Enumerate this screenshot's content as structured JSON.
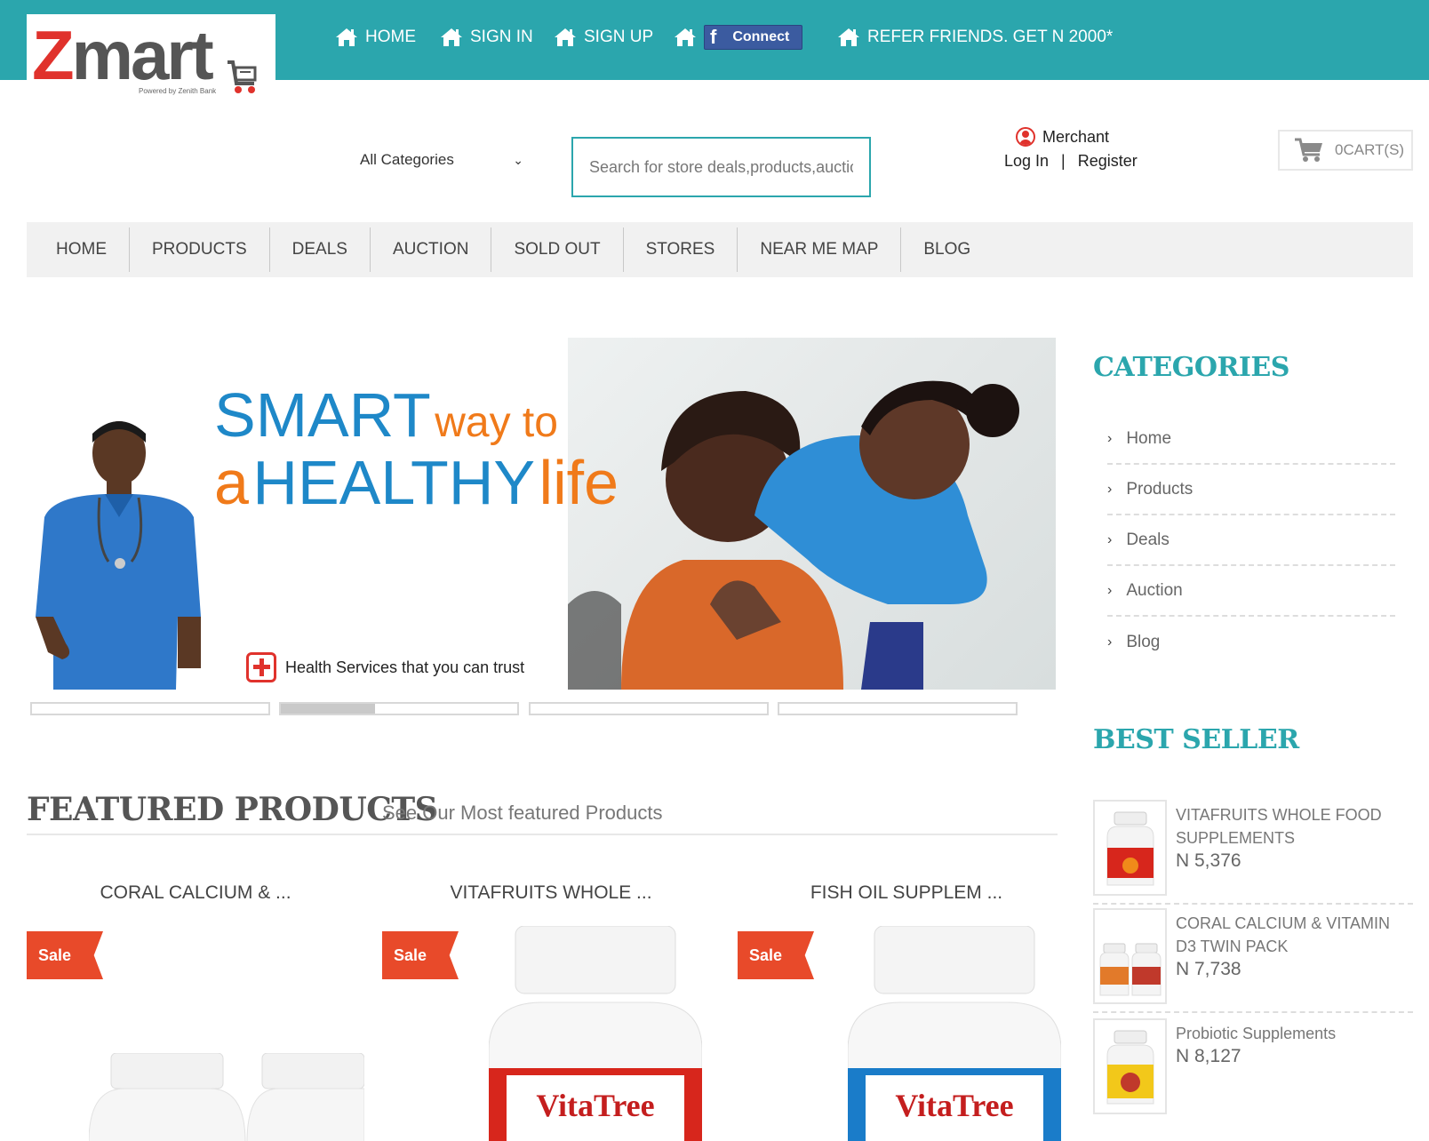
{
  "header": {
    "logo_text_z": "Z",
    "logo_text_rest": "mart",
    "logo_sub": "Powered by Zenith Bank",
    "top_nav": [
      {
        "label": "HOME"
      },
      {
        "label": "SIGN IN"
      },
      {
        "label": "SIGN UP"
      },
      {
        "label": ""
      },
      {
        "label": "REFER FRIENDS. GET N 2000*"
      }
    ],
    "facebook_connect_label": "Connect",
    "category_select": "All Categories",
    "search_placeholder": "Search for store deals,products,auctions",
    "merchant_label": "Merchant",
    "login_label": "Log In",
    "separator": "|",
    "register_label": "Register",
    "cart_label": "0CART(S)"
  },
  "main_nav": [
    "HOME",
    "PRODUCTS",
    "DEALS",
    "AUCTION",
    "SOLD OUT",
    "STORES",
    "NEAR ME MAP",
    "BLOG"
  ],
  "banner": {
    "line1_a": "SMART",
    "line1_b": "way to",
    "line2_a": "a",
    "line2_b": "HEALTHY",
    "line2_c": "life",
    "trust_text": "Health Services that you can trust",
    "slides": [
      {
        "progress": 0
      },
      {
        "progress": 0.4
      },
      {
        "progress": 0
      },
      {
        "progress": 0
      }
    ]
  },
  "featured": {
    "title": "FEATURED PRODUCTS",
    "subtitle": "See Our Most featured Products",
    "products": [
      {
        "name": "CORAL CALCIUM & ...",
        "badge": "Sale"
      },
      {
        "name": "VITAFRUITS WHOLE ...",
        "badge": "Sale",
        "brand": "VitaTree"
      },
      {
        "name": "FISH OIL SUPPLEM ...",
        "badge": "Sale",
        "brand": "VitaTree"
      }
    ]
  },
  "sidebar": {
    "categories_title": "CATEGORIES",
    "categories": [
      "Home",
      "Products",
      "Deals",
      "Auction",
      "Blog"
    ],
    "best_seller_title": "BEST SELLER",
    "best_sellers": [
      {
        "name": "VITAFRUITS WHOLE FOOD SUPPLEMENTS",
        "price": "N 5,376"
      },
      {
        "name": "CORAL CALCIUM & VITAMIN D3 TWIN PACK",
        "price": "N 7,738"
      },
      {
        "name": "Probiotic Supplements",
        "price": "N 8,127"
      }
    ]
  },
  "colors": {
    "teal": "#2ba6ad",
    "logo_red": "#e0322c",
    "sale_orange": "#e84a2a",
    "banner_blue": "#1e88c8",
    "banner_orange": "#f07a1a"
  }
}
